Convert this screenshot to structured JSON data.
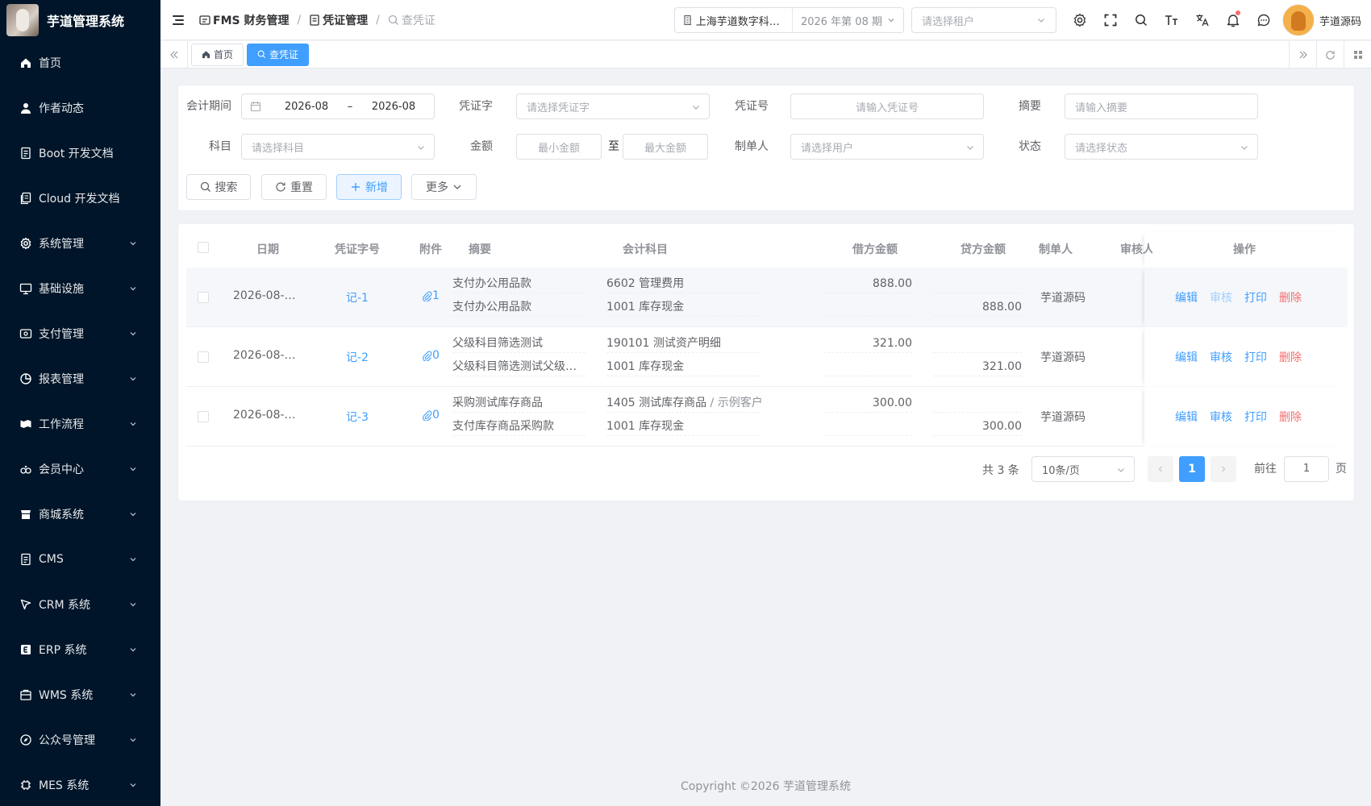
{
  "app": {
    "title": "芋道管理系统"
  },
  "sidebar": {
    "items": [
      {
        "label": "首页",
        "icon": "home-icon",
        "has_children": false
      },
      {
        "label": "作者动态",
        "icon": "user-icon",
        "has_children": false
      },
      {
        "label": "Boot 开发文档",
        "icon": "document-icon",
        "has_children": false
      },
      {
        "label": "Cloud 开发文档",
        "icon": "documents-icon",
        "has_children": false
      },
      {
        "label": "系统管理",
        "icon": "gear-icon",
        "has_children": true
      },
      {
        "label": "基础设施",
        "icon": "monitor-icon",
        "has_children": true
      },
      {
        "label": "支付管理",
        "icon": "payment-icon",
        "has_children": true
      },
      {
        "label": "报表管理",
        "icon": "pie-chart-icon",
        "has_children": true
      },
      {
        "label": "工作流程",
        "icon": "workflow-icon",
        "has_children": true
      },
      {
        "label": "会员中心",
        "icon": "members-icon",
        "has_children": true
      },
      {
        "label": "商城系统",
        "icon": "shop-icon",
        "has_children": true
      },
      {
        "label": "CMS",
        "icon": "document-icon",
        "has_children": true
      },
      {
        "label": "CRM 系统",
        "icon": "crm-icon",
        "has_children": true
      },
      {
        "label": "ERP 系统",
        "icon": "erp-icon",
        "has_children": true
      },
      {
        "label": "WMS 系统",
        "icon": "warehouse-icon",
        "has_children": true
      },
      {
        "label": "公众号管理",
        "icon": "compass-icon",
        "has_children": true
      },
      {
        "label": "MES 系统",
        "icon": "chip-icon",
        "has_children": true
      }
    ]
  },
  "header": {
    "breadcrumb": [
      "FMS 财务管理",
      "凭证管理",
      "查凭证"
    ],
    "company": "上海芋道数字科技有限公司",
    "period": "2026 年第 08 期",
    "tenant_placeholder": "请选择租户",
    "user_name": "芋道源码"
  },
  "tabs": [
    {
      "label": "首页",
      "active": false
    },
    {
      "label": "查凭证",
      "active": true
    }
  ],
  "search": {
    "period_label": "会计期间",
    "period_start": "2026-08",
    "period_sep": "–",
    "period_end": "2026-08",
    "voucher_word_label": "凭证字",
    "voucher_word_placeholder": "请选择凭证字",
    "voucher_no_label": "凭证号",
    "voucher_no_placeholder": "请输入凭证号",
    "summary_label": "摘要",
    "summary_placeholder": "请输入摘要",
    "subject_label": "科目",
    "subject_placeholder": "请选择科目",
    "amount_label": "金额",
    "amount_min_placeholder": "最小金额",
    "amount_to": "至",
    "amount_max_placeholder": "最大金额",
    "creator_label": "制单人",
    "creator_placeholder": "请选择用户",
    "status_label": "状态",
    "status_placeholder": "请选择状态",
    "search_btn": "搜索",
    "reset_btn": "重置",
    "add_btn": "新增",
    "more_btn": "更多"
  },
  "table": {
    "headers": {
      "date": "日期",
      "voucher": "凭证字号",
      "attach": "附件",
      "summary": "摘要",
      "subject": "会计科目",
      "debit": "借方金额",
      "credit": "贷方金额",
      "creator": "制单人",
      "audit": "审核人",
      "ops": "操作"
    },
    "rows": [
      {
        "date": "2026-08-…",
        "voucher": "记-1",
        "attach": "1",
        "lines": [
          {
            "summary": "支付办公用品款",
            "subject": "6602 管理费用",
            "subject_extra": "",
            "debit": "888.00",
            "credit": ""
          },
          {
            "summary": "支付办公用品款",
            "subject": "1001 库存现金",
            "subject_extra": "",
            "debit": "",
            "credit": "888.00"
          }
        ],
        "creator": "芋道源码",
        "ops": {
          "edit": "编辑",
          "audit": "审核",
          "print": "打印",
          "delete": "删除"
        },
        "audit_disabled": true
      },
      {
        "date": "2026-08-…",
        "voucher": "记-2",
        "attach": "0",
        "lines": [
          {
            "summary": "父级科目筛选测试",
            "subject": "190101 测试资产明细",
            "subject_extra": "",
            "debit": "321.00",
            "credit": ""
          },
          {
            "summary": "父级科目筛选测试父级…",
            "subject": "1001 库存现金",
            "subject_extra": "",
            "debit": "",
            "credit": "321.00"
          }
        ],
        "creator": "芋道源码",
        "ops": {
          "edit": "编辑",
          "audit": "审核",
          "print": "打印",
          "delete": "删除"
        },
        "audit_disabled": false
      },
      {
        "date": "2026-08-…",
        "voucher": "记-3",
        "attach": "0",
        "lines": [
          {
            "summary": "采购测试库存商品",
            "subject": "1405 测试库存商品",
            "subject_extra": "/ 示例客户",
            "debit": "300.00",
            "credit": ""
          },
          {
            "summary": "支付库存商品采购款",
            "subject": "1001 库存现金",
            "subject_extra": "",
            "debit": "",
            "credit": "300.00"
          }
        ],
        "creator": "芋道源码",
        "ops": {
          "edit": "编辑",
          "audit": "审核",
          "print": "打印",
          "delete": "删除"
        },
        "audit_disabled": false
      }
    ]
  },
  "pagination": {
    "total": "共 3 条",
    "page_size": "10条/页",
    "current_page": "1",
    "goto_label": "前往",
    "goto_value": "1",
    "page_unit": "页"
  },
  "footer": {
    "copyright": "Copyright ©2026 芋道管理系统"
  },
  "colors": {
    "sidebar_bg": "#001529",
    "primary": "#409eff",
    "danger": "#f56c6c"
  }
}
